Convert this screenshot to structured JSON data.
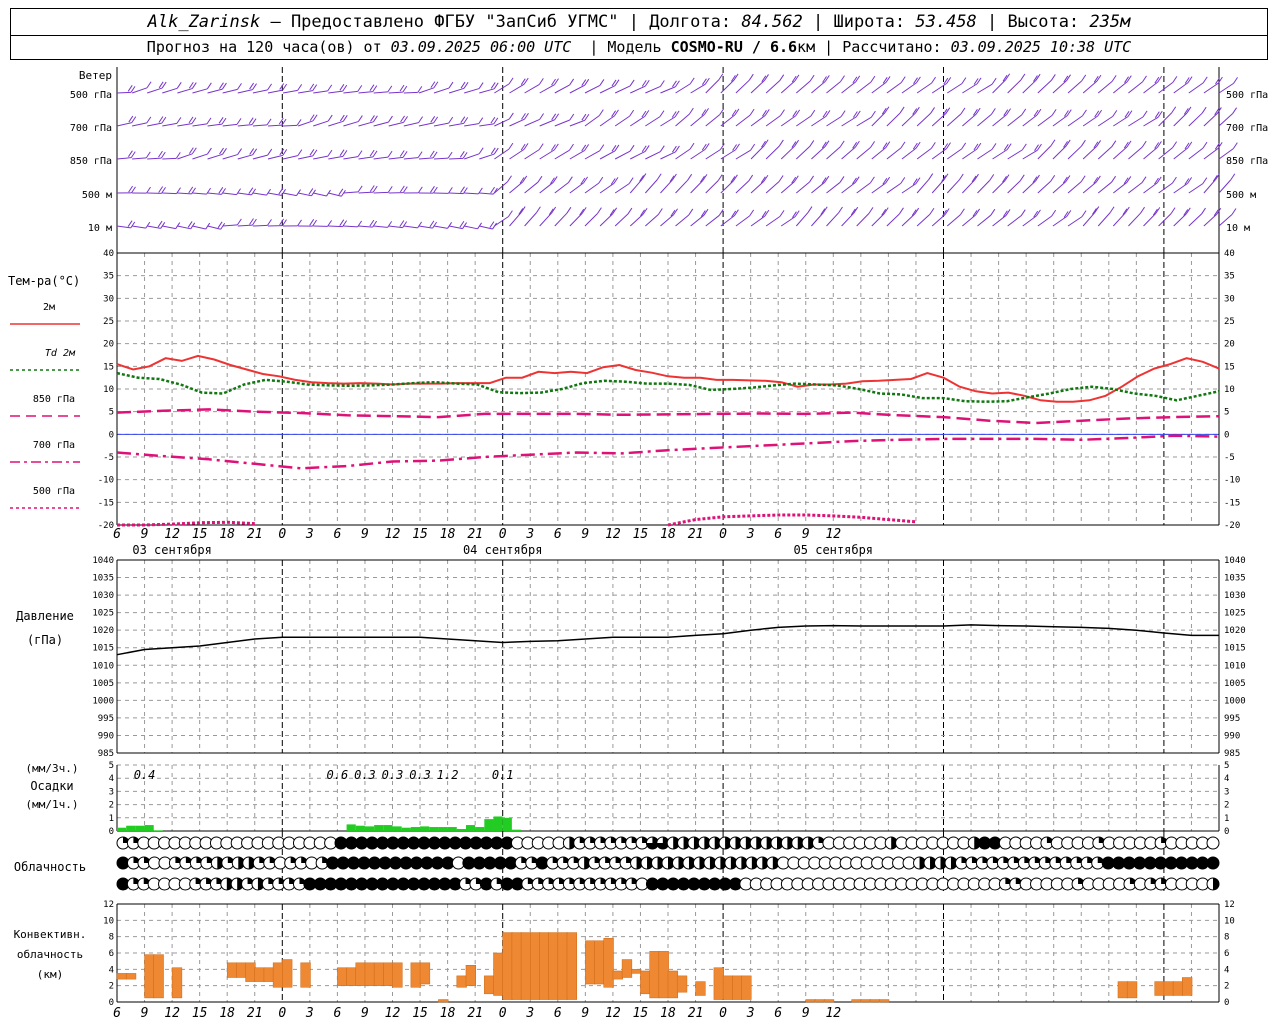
{
  "header": {
    "station": "Alk_Zarinsk",
    "provider": "– Предоставлено ФГБУ \"ЗапСиб УГМС\"",
    "lon_label": "Долгота:",
    "lon": "84.562",
    "lat_label": "Широта:",
    "lat": "53.458",
    "alt_label": "Высота:",
    "alt": "235м",
    "forecast_label": "Прогноз на 120 часа(ов) от",
    "forecast_start": "03.09.2025 06:00 UTC",
    "model_label": "Модель",
    "model": "COSMO-RU / 6.6",
    "model_unit": "км",
    "calc_label": "Рассчитано:",
    "calc_time": "03.09.2025 10:38 UTC"
  },
  "time_axis": {
    "hour_ticks": [
      "6",
      "9",
      "12",
      "15",
      "18",
      "21",
      "0",
      "3",
      "6",
      "9",
      "12",
      "15",
      "18",
      "21",
      "0",
      "3",
      "6",
      "9",
      "12",
      "15",
      "18",
      "21",
      "0",
      "3",
      "6",
      "9",
      "12"
    ],
    "date_labels": [
      "03 сентября",
      "04 сентября",
      "05 сентября"
    ]
  },
  "wind": {
    "title": "Ветер",
    "levels": [
      "500 гПа",
      "700 гПа",
      "850 гПа",
      "500 м",
      "10  м"
    ]
  },
  "temperature": {
    "title": "Тем-ра(°C)",
    "legend": [
      {
        "label": "2м",
        "color": "#ee3333",
        "style": "solid"
      },
      {
        "label": "Td  2м",
        "color": "#117711",
        "style": "dotted"
      },
      {
        "label": "850 гПа",
        "color": "#dd1177",
        "style": "dashed"
      },
      {
        "label": "700 гПа",
        "color": "#dd1177",
        "style": "dashdot"
      },
      {
        "label": "500 гПа",
        "color": "#dd1177",
        "style": "dotted"
      }
    ],
    "ticks": [
      "40",
      "35",
      "30",
      "25",
      "20",
      "15",
      "10",
      "5",
      "0",
      "-5",
      "-10",
      "-15",
      "-20"
    ]
  },
  "pressure": {
    "title_1": "Давление",
    "title_2": "(гПа)",
    "ticks": [
      "1040",
      "1035",
      "1030",
      "1025",
      "1020",
      "1015",
      "1010",
      "1005",
      "1000",
      "995",
      "990",
      "985"
    ]
  },
  "precip": {
    "title_1": "(мм/3ч.)",
    "title_2": "Осадки",
    "title_3": "(мм/1ч.)",
    "ticks": [
      "5",
      "4",
      "3",
      "2",
      "1",
      "0"
    ],
    "labels": [
      {
        "t": 3,
        "text": "0.4"
      },
      {
        "t": 24,
        "text": "0.6"
      },
      {
        "t": 27,
        "text": "0.3"
      },
      {
        "t": 30,
        "text": "0.3"
      },
      {
        "t": 33,
        "text": "0.3"
      },
      {
        "t": 36,
        "text": "1.2"
      },
      {
        "t": 42,
        "text": "0.1"
      }
    ]
  },
  "cloud": {
    "title": "Облачность",
    "rows": [
      "qqo000000000000000000fffffffffffffffff00000hqqqqqqqtthhhhhhhhhhhhhhq000000h0000000hff0000q0000q00000q00000",
      "fqq00qqqqhqhhqq0qq0qffffffffffff0fffffqqfqqqhqqqqhhhhhhhhhhhhhh0000000000000hhhhqqqqqqqqqqqqqqfffffffffff",
      "fqq0000qqqhhqhqqqqfffffffffffffffqqfqffqqqqqqqqqqq0fffffffff0000000000000000000000000qq00000q0000q0qq0000h"
    ]
  },
  "convective": {
    "title_1": "Конвективн.",
    "title_2": "облачность",
    "title_3": "(км)",
    "ticks": [
      "12",
      "10",
      "8",
      "6",
      "4",
      "2",
      "0"
    ]
  },
  "chart_data": {
    "type": "line",
    "x_unit": "hours from 03.09.2025 06:00 UTC",
    "temperature": {
      "ylim": [
        -20,
        40
      ],
      "series": [
        {
          "name": "2м",
          "x": [
            0,
            1,
            3,
            5,
            7,
            9,
            11,
            13,
            15,
            17,
            19,
            21,
            24,
            27,
            29,
            30,
            32,
            33,
            35,
            37,
            39,
            41,
            44,
            47,
            50,
            52,
            54,
            56,
            58,
            60,
            63,
            66,
            69,
            71,
            75,
            78,
            81,
            84,
            87,
            90,
            93,
            96,
            99,
            102,
            105,
            108,
            111,
            114,
            117,
            120
          ],
          "values": [
            15.5,
            14.3,
            15,
            16.8,
            16.2,
            17.3,
            16.5,
            15.3,
            14.3,
            13.3,
            12.8,
            12,
            11.5,
            11.3,
            11.2,
            11.3,
            11.2,
            11,
            11.2,
            11.2,
            11.2,
            11.3,
            11.3,
            11.3,
            12.5,
            12.5,
            13.8,
            13.5,
            13.8,
            13.5,
            14.8,
            15.3,
            14.2,
            13.6,
            12.8,
            12.5,
            12.5,
            12,
            12,
            11.9,
            11.8,
            11.5,
            10.5,
            11,
            11,
            11.2,
            11.7,
            11.8,
            12,
            12.2,
            13.5,
            12.5,
            10.5,
            9.5,
            9,
            9.2,
            8.5,
            7.5,
            7.2,
            7.2,
            7.5,
            8.5,
            10.5,
            12.8,
            14.5,
            15.5,
            16.8,
            16,
            14.5
          ]
        },
        {
          "name": "Td  2м",
          "x": [
            0,
            2,
            4,
            6,
            9,
            11,
            13,
            15,
            18,
            21,
            24,
            27,
            30,
            33,
            36,
            39,
            42,
            45,
            48,
            51,
            54,
            57,
            60,
            63,
            66,
            69,
            72,
            75,
            78,
            81,
            84,
            87,
            90,
            93,
            96,
            99,
            102,
            105,
            108,
            111,
            114,
            117,
            120
          ],
          "values": [
            13.5,
            12.5,
            12.2,
            11,
            9.2,
            9,
            11,
            12,
            11.6,
            11,
            10.8,
            10.7,
            10.8,
            11,
            11.3,
            11.5,
            11.2,
            11,
            9.3,
            9.1,
            9.2,
            10,
            11.3,
            11.8,
            11.6,
            11.2,
            11.2,
            10.9,
            9.8,
            10,
            10.3,
            10.8,
            11.2,
            11,
            10.8,
            10,
            9,
            8.8,
            8,
            8,
            7.3,
            7.2,
            7.3,
            8.2,
            9,
            10,
            10.5,
            10,
            9,
            8.5,
            7.5,
            8.5,
            9.5
          ]
        },
        {
          "name": "850 гПа",
          "x": [
            0,
            6,
            12,
            18,
            24,
            30,
            36,
            42,
            48,
            54,
            60,
            66,
            72,
            78,
            84,
            90,
            96,
            102,
            108,
            114,
            120
          ],
          "values": [
            4.8,
            5.2,
            5.5,
            5,
            4.7,
            4.2,
            4,
            3.8,
            4.5,
            4.5,
            4.5,
            4.3,
            4.4,
            4.5,
            4.6,
            4.5,
            4.8,
            4.2,
            3.8,
            3,
            2.5,
            3,
            3.5,
            3.8,
            4
          ]
        },
        {
          "name": "700 гПа",
          "x": [
            0,
            6,
            12,
            18,
            24,
            30,
            36,
            42,
            48,
            54,
            60,
            66,
            72,
            78,
            84,
            90,
            96,
            102,
            108,
            114,
            120
          ],
          "values": [
            -4,
            -4.8,
            -5.5,
            -6.5,
            -7.5,
            -7,
            -6,
            -5.8,
            -5,
            -4.5,
            -4,
            -4.2,
            -3.5,
            -3,
            -2.5,
            -2,
            -1.5,
            -1.2,
            -1,
            -1,
            -1,
            -1.2,
            -0.8,
            -0.3,
            -0.5
          ]
        },
        {
          "name": "500 гПа",
          "x": [
            0,
            3,
            6,
            9,
            12,
            15,
            18,
            21,
            24,
            27,
            30,
            33,
            36,
            39,
            42,
            45,
            48,
            51,
            54,
            57,
            60,
            63,
            66,
            69,
            72,
            75,
            78,
            81,
            84,
            87,
            90,
            93,
            96,
            99,
            102,
            105,
            108,
            111,
            114,
            117,
            120
          ],
          "values": [
            -20,
            -20,
            -19.8,
            -19.5,
            -19.4,
            -19.7,
            -20.5,
            -22,
            -22,
            -22,
            -22,
            -22,
            -22,
            -22,
            -22,
            -22,
            -22,
            -22,
            -22,
            -22,
            -20,
            -18.8,
            -18.2,
            -18,
            -17.8,
            -17.8,
            -18,
            -18.3,
            -18.8,
            -19.3,
            -20.2,
            -22,
            -22,
            -22,
            -22,
            -22,
            -22,
            -22,
            -22,
            -22,
            -22
          ]
        }
      ]
    },
    "pressure": {
      "ylim": [
        985,
        1040
      ],
      "series": [
        {
          "name": "Давление",
          "x": [
            0,
            3,
            6,
            9,
            12,
            15,
            18,
            21,
            24,
            27,
            30,
            33,
            36,
            39,
            42,
            45,
            48,
            51,
            54,
            57,
            60,
            63,
            66,
            69,
            72,
            75,
            78,
            81,
            84,
            87,
            90,
            93,
            96,
            99,
            102,
            105,
            108,
            111,
            114,
            117,
            120
          ],
          "values": [
            1013,
            1014.5,
            1015,
            1015.5,
            1016.5,
            1017.5,
            1018,
            1018,
            1018,
            1018,
            1018,
            1018,
            1017.5,
            1017,
            1016.5,
            1016.8,
            1017,
            1017.5,
            1018,
            1018,
            1018,
            1018.5,
            1019,
            1020,
            1020.8,
            1021.2,
            1021.3,
            1021.2,
            1021.2,
            1021.2,
            1021.2,
            1021.5,
            1021.3,
            1021.2,
            1021,
            1020.8,
            1020.5,
            1020,
            1019.2,
            1018.5,
            1018.5
          ]
        }
      ]
    },
    "precipitation_mm_1h": {
      "ylim": [
        0,
        5
      ],
      "x_start": [
        0,
        1,
        2,
        3,
        4,
        25,
        26,
        27,
        28,
        29,
        30,
        31,
        32,
        33,
        34,
        35,
        36,
        37,
        38,
        39,
        40,
        41,
        42,
        43
      ],
      "values": [
        0.25,
        0.4,
        0.4,
        0.45,
        0.05,
        0.5,
        0.4,
        0.35,
        0.45,
        0.45,
        0.35,
        0.25,
        0.3,
        0.35,
        0.3,
        0.3,
        0.3,
        0.15,
        0.45,
        0.3,
        0.9,
        1.1,
        1.0,
        0.1
      ]
    },
    "convective_cloud_km": {
      "ylim": [
        0,
        12
      ],
      "bars": [
        {
          "x": 0,
          "bottom": 2.8,
          "top": 3.5
        },
        {
          "x": 1,
          "bottom": 2.8,
          "top": 3.5
        },
        {
          "x": 3,
          "bottom": 0.5,
          "top": 5.8
        },
        {
          "x": 4,
          "bottom": 0.5,
          "top": 5.8
        },
        {
          "x": 6,
          "bottom": 0.5,
          "top": 4.2
        },
        {
          "x": 12,
          "bottom": 3.0,
          "top": 4.8
        },
        {
          "x": 13,
          "bottom": 3.0,
          "top": 4.8
        },
        {
          "x": 14,
          "bottom": 2.5,
          "top": 4.8
        },
        {
          "x": 15,
          "bottom": 2.5,
          "top": 4.2
        },
        {
          "x": 16,
          "bottom": 2.5,
          "top": 4.2
        },
        {
          "x": 17,
          "bottom": 1.8,
          "top": 4.8
        },
        {
          "x": 18,
          "bottom": 1.8,
          "top": 5.2
        },
        {
          "x": 20,
          "bottom": 1.8,
          "top": 4.8
        },
        {
          "x": 24,
          "bottom": 2.0,
          "top": 4.2
        },
        {
          "x": 25,
          "bottom": 2.0,
          "top": 4.2
        },
        {
          "x": 26,
          "bottom": 2.0,
          "top": 4.8
        },
        {
          "x": 27,
          "bottom": 2.0,
          "top": 4.8
        },
        {
          "x": 28,
          "bottom": 2.0,
          "top": 4.8
        },
        {
          "x": 29,
          "bottom": 2.0,
          "top": 4.8
        },
        {
          "x": 30,
          "bottom": 1.8,
          "top": 4.8
        },
        {
          "x": 32,
          "bottom": 1.8,
          "top": 4.8
        },
        {
          "x": 33,
          "bottom": 2.2,
          "top": 4.8
        },
        {
          "x": 35,
          "bottom": 0,
          "top": 0.3
        },
        {
          "x": 37,
          "bottom": 1.8,
          "top": 3.2
        },
        {
          "x": 38,
          "bottom": 2.0,
          "top": 4.5
        },
        {
          "x": 40,
          "bottom": 1.0,
          "top": 3.2
        },
        {
          "x": 41,
          "bottom": 0.8,
          "top": 6.0
        },
        {
          "x": 42,
          "bottom": 0.3,
          "top": 8.5
        },
        {
          "x": 43,
          "bottom": 0.3,
          "top": 8.5
        },
        {
          "x": 44,
          "bottom": 0.3,
          "top": 8.5
        },
        {
          "x": 45,
          "bottom": 0.3,
          "top": 8.5
        },
        {
          "x": 46,
          "bottom": 0.3,
          "top": 8.5
        },
        {
          "x": 47,
          "bottom": 0.3,
          "top": 8.5
        },
        {
          "x": 48,
          "bottom": 0.3,
          "top": 8.5
        },
        {
          "x": 49,
          "bottom": 0.3,
          "top": 8.5
        },
        {
          "x": 51,
          "bottom": 2.2,
          "top": 7.5
        },
        {
          "x": 52,
          "bottom": 2.2,
          "top": 7.5
        },
        {
          "x": 53,
          "bottom": 1.8,
          "top": 7.8
        },
        {
          "x": 54,
          "bottom": 2.8,
          "top": 3.8
        },
        {
          "x": 55,
          "bottom": 3.0,
          "top": 5.2
        },
        {
          "x": 56,
          "bottom": 3.5,
          "top": 4.0
        },
        {
          "x": 57,
          "bottom": 1.0,
          "top": 3.8
        },
        {
          "x": 58,
          "bottom": 0.5,
          "top": 6.2
        },
        {
          "x": 59,
          "bottom": 0.5,
          "top": 6.2
        },
        {
          "x": 60,
          "bottom": 0.5,
          "top": 3.8
        },
        {
          "x": 61,
          "bottom": 1.2,
          "top": 3.2
        },
        {
          "x": 63,
          "bottom": 0.8,
          "top": 2.5
        },
        {
          "x": 65,
          "bottom": 0.3,
          "top": 4.2
        },
        {
          "x": 66,
          "bottom": 0.3,
          "top": 3.2
        },
        {
          "x": 67,
          "bottom": 0.3,
          "top": 3.2
        },
        {
          "x": 68,
          "bottom": 0.3,
          "top": 3.2
        },
        {
          "x": 75,
          "bottom": 0,
          "top": 0.3
        },
        {
          "x": 76,
          "bottom": 0,
          "top": 0.3
        },
        {
          "x": 77,
          "bottom": 0,
          "top": 0.3
        },
        {
          "x": 80,
          "bottom": 0,
          "top": 0.3
        },
        {
          "x": 81,
          "bottom": 0,
          "top": 0.3
        },
        {
          "x": 82,
          "bottom": 0,
          "top": 0.3
        },
        {
          "x": 83,
          "bottom": 0,
          "top": 0.3
        },
        {
          "x": 109,
          "bottom": 0.5,
          "top": 2.5
        },
        {
          "x": 110,
          "bottom": 0.5,
          "top": 2.5
        },
        {
          "x": 113,
          "bottom": 0.8,
          "top": 2.5
        },
        {
          "x": 114,
          "bottom": 0.8,
          "top": 2.5
        },
        {
          "x": 115,
          "bottom": 0.8,
          "top": 2.5
        },
        {
          "x": 116,
          "bottom": 0.8,
          "top": 3.0
        }
      ]
    }
  }
}
